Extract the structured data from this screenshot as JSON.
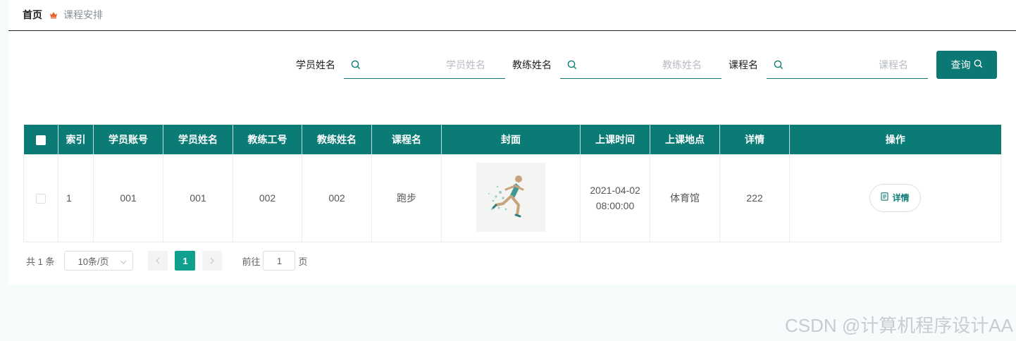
{
  "breadcrumb": {
    "home": "首页",
    "current": "课程安排"
  },
  "search": {
    "student_name_label": "学员姓名",
    "student_name_placeholder": "学员姓名",
    "coach_name_label": "教练姓名",
    "coach_name_placeholder": "教练姓名",
    "course_name_label": "课程名",
    "course_name_placeholder": "课程名",
    "query_label": "查询"
  },
  "table": {
    "headers": [
      "索引",
      "学员账号",
      "学员姓名",
      "教练工号",
      "教练姓名",
      "课程名",
      "封面",
      "上课时间",
      "上课地点",
      "详情",
      "操作"
    ],
    "rows": [
      {
        "index": "1",
        "student_account": "001",
        "student_name": "001",
        "coach_id": "002",
        "coach_name": "002",
        "course_name": "跑步",
        "cover_icon": "runner-image",
        "time_date": "2021-04-02",
        "time_clock": "08:00:00",
        "location": "体育馆",
        "detail": "222",
        "action_label": "详情"
      }
    ]
  },
  "pagination": {
    "total": "共 1 条",
    "page_size": "10条/页",
    "current_page": "1",
    "goto_label": "前往",
    "goto_value": "1",
    "page_suffix": "页"
  },
  "watermark": "CSDN @计算机程序设计AA",
  "colors": {
    "primary": "#0b7b76",
    "page_active": "#0fa08e",
    "crumb_icon": "#e8602c"
  }
}
